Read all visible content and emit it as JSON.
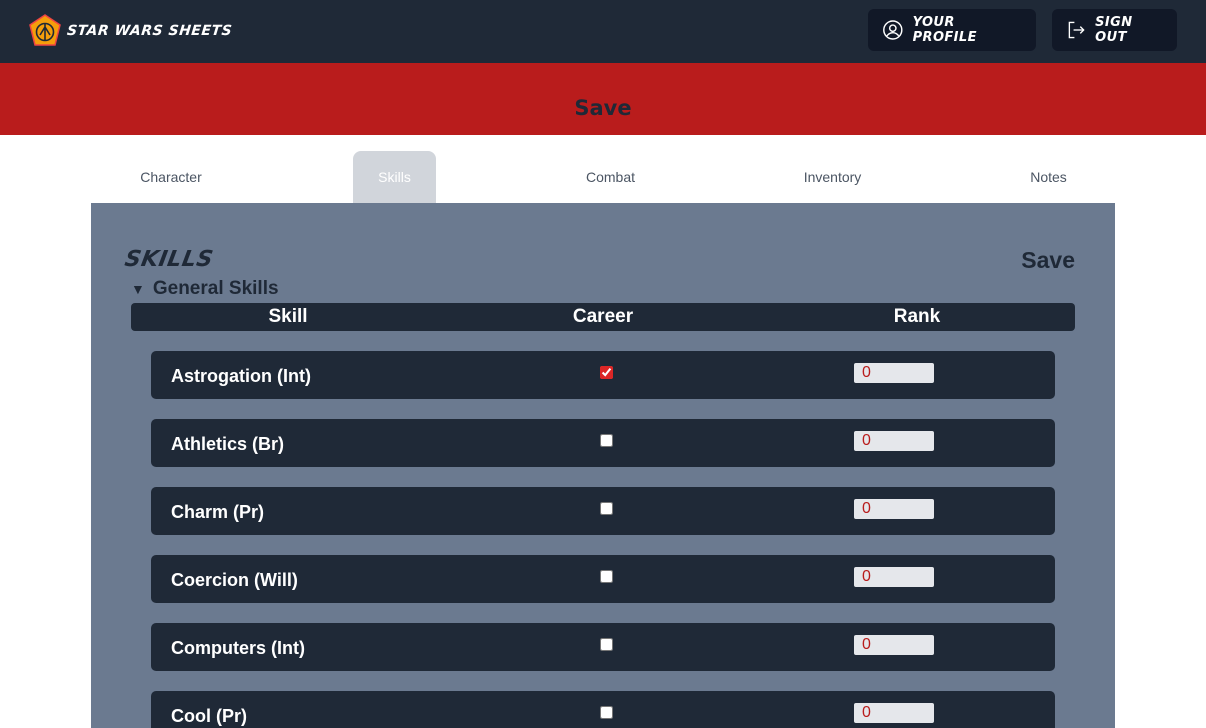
{
  "brand": {
    "title": "Star Wars Sheets",
    "logo_icon": "rebel-alliance-icon"
  },
  "nav": {
    "profile_label": "Your Profile",
    "profile_icon": "user-circle-icon",
    "signout_label": "Sign Out",
    "signout_icon": "sign-out-icon"
  },
  "banner": {
    "save_label": "Save"
  },
  "tabs": [
    {
      "label": "Character",
      "active": false
    },
    {
      "label": "Skills",
      "active": true
    },
    {
      "label": "Combat",
      "active": false
    },
    {
      "label": "Inventory",
      "active": false
    },
    {
      "label": "Notes",
      "active": false
    }
  ],
  "skills_panel": {
    "title": "Skills",
    "save_label": "Save",
    "group": {
      "name": "General Skills",
      "expanded": true
    },
    "columns": {
      "skill": "Skill",
      "career": "Career",
      "rank": "Rank"
    },
    "rows": [
      {
        "name": "Astrogation (Int)",
        "career": true,
        "rank": "0"
      },
      {
        "name": "Athletics (Br)",
        "career": false,
        "rank": "0"
      },
      {
        "name": "Charm (Pr)",
        "career": false,
        "rank": "0"
      },
      {
        "name": "Coercion (Will)",
        "career": false,
        "rank": "0"
      },
      {
        "name": "Computers (Int)",
        "career": false,
        "rank": "0"
      },
      {
        "name": "Cool (Pr)",
        "career": false,
        "rank": "0"
      }
    ]
  },
  "colors": {
    "header_bg": "#1f2937",
    "banner_bg": "#b91c1c",
    "panel_bg": "#6b7a90",
    "active_tab": "#d1d5db",
    "rank_text": "#b91c1c"
  }
}
